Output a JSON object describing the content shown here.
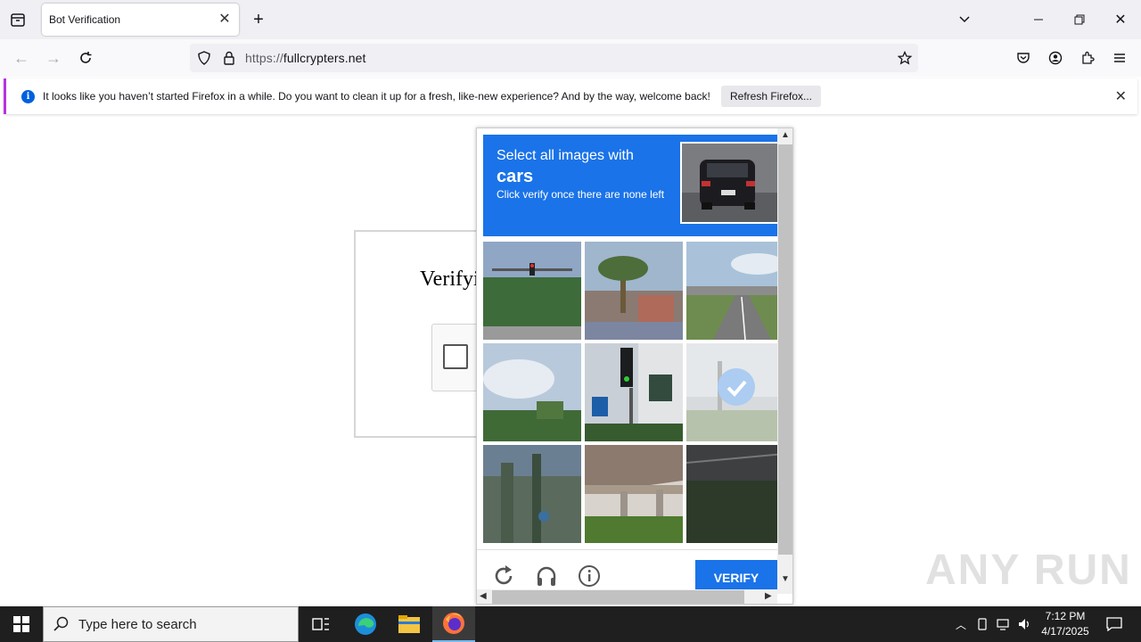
{
  "browser": {
    "tab_title": "Bot Verification",
    "url_protocol": "https://",
    "url_host": "fullcrypters.net"
  },
  "notification": {
    "message": "It looks like you haven’t started Firefox in a while. Do you want to clean it up for a fresh, like-new experience? And by the way, welcome back!",
    "button_label": "Refresh Firefox..."
  },
  "page": {
    "verify_text": "Verifyi"
  },
  "captcha": {
    "instruction_line1": "Select all images with",
    "target_word": "cars",
    "instruction_line3": "Click verify once there are none left",
    "verify_label": "VERIFY",
    "tiles": [
      {
        "subject": "traffic-lights-trees",
        "selected": false
      },
      {
        "subject": "palm-tree-house",
        "selected": false
      },
      {
        "subject": "highway-overpass",
        "selected": false
      },
      {
        "subject": "clouds-trees",
        "selected": false
      },
      {
        "subject": "traffic-light-building",
        "selected": false
      },
      {
        "subject": "street-scene",
        "selected": true
      },
      {
        "subject": "plants-structure",
        "selected": false
      },
      {
        "subject": "bridge-underside",
        "selected": false
      },
      {
        "subject": "dark-road",
        "selected": false
      }
    ]
  },
  "watermark": "ANY RUN",
  "taskbar": {
    "search_placeholder": "Type here to search",
    "time": "7:12 PM",
    "date": "4/17/2025"
  },
  "colors": {
    "accent": "#1a73e8",
    "firefox_info": "#0060df"
  }
}
